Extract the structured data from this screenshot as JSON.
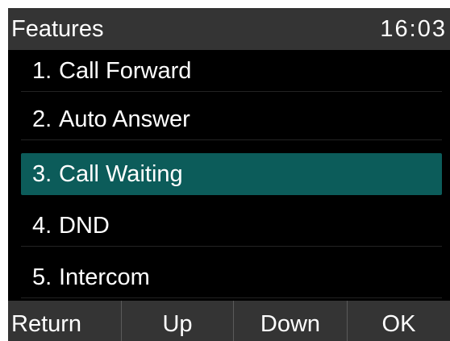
{
  "header": {
    "title": "Features",
    "clock": "16:03"
  },
  "menu": {
    "items": [
      {
        "num": "1.",
        "label": "Call Forward",
        "selected": false
      },
      {
        "num": "2.",
        "label": "Auto Answer",
        "selected": false
      },
      {
        "num": "3.",
        "label": "Call Waiting",
        "selected": true
      },
      {
        "num": "4.",
        "label": "DND",
        "selected": false
      },
      {
        "num": "5.",
        "label": "Intercom",
        "selected": false
      }
    ]
  },
  "softkeys": {
    "return_label": "Return",
    "up_label": "Up",
    "down_label": "Down",
    "ok_label": "OK"
  },
  "colors": {
    "screen_bg": "#000000",
    "bar_bg": "#343434",
    "highlight": "#0c5c5a",
    "text": "#ffffff"
  }
}
